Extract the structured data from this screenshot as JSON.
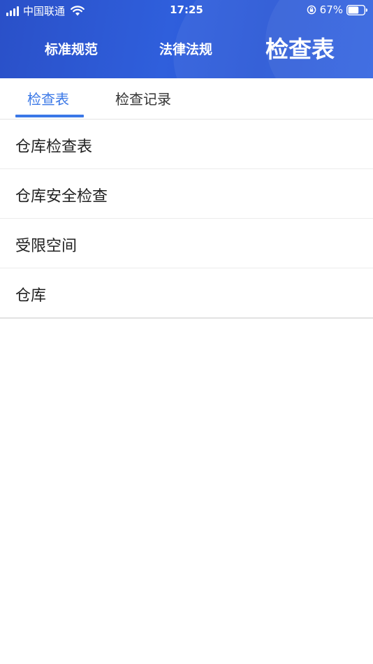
{
  "status_bar": {
    "carrier": "中国联通",
    "time": "17:25",
    "battery_percent": "67%",
    "battery_level": 0.67,
    "icons": [
      "signal-icon",
      "wifi-icon",
      "orientation-lock-icon",
      "battery-icon"
    ]
  },
  "top_nav": {
    "items": [
      {
        "label": "标准规范",
        "active": false
      },
      {
        "label": "法律法规",
        "active": false
      },
      {
        "label": "检查表",
        "active": true
      }
    ]
  },
  "sub_tabs": {
    "items": [
      {
        "label": "检查表",
        "active": true
      },
      {
        "label": "检查记录",
        "active": false
      }
    ]
  },
  "checklist": {
    "items": [
      {
        "label": "仓库检查表"
      },
      {
        "label": "仓库安全检查"
      },
      {
        "label": "受限空间"
      },
      {
        "label": "仓库"
      }
    ]
  },
  "colors": {
    "header_bg": "#2f5fdc",
    "accent": "#3b78e7",
    "text": "#222222"
  }
}
